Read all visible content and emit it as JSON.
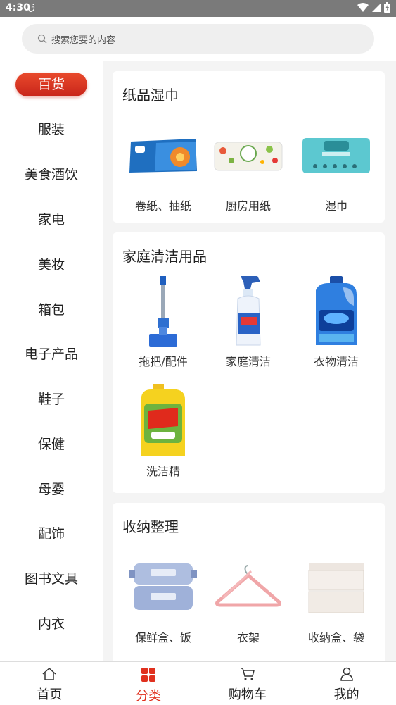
{
  "status_bar": {
    "time": "4:30",
    "carrier_glyph": "ق"
  },
  "search": {
    "placeholder": "搜索您要的内容"
  },
  "sidebar": {
    "items": [
      {
        "label": "百货"
      },
      {
        "label": "服装"
      },
      {
        "label": "美食酒饮"
      },
      {
        "label": "家电"
      },
      {
        "label": "美妆"
      },
      {
        "label": "箱包"
      },
      {
        "label": "电子产品"
      },
      {
        "label": "鞋子"
      },
      {
        "label": "保健"
      },
      {
        "label": "母婴"
      },
      {
        "label": "配饰"
      },
      {
        "label": "图书文具"
      },
      {
        "label": "内衣"
      }
    ],
    "active_index": 0
  },
  "sections": [
    {
      "title": "纸品湿巾",
      "products": [
        {
          "label": "卷纸、抽纸"
        },
        {
          "label": "厨房用纸"
        },
        {
          "label": "湿巾"
        }
      ]
    },
    {
      "title": "家庭清洁用品",
      "products": [
        {
          "label": "拖把/配件"
        },
        {
          "label": "家庭清洁"
        },
        {
          "label": "衣物清洁"
        },
        {
          "label": "洗洁精"
        }
      ]
    },
    {
      "title": "收纳整理",
      "products": [
        {
          "label": "保鲜盒、饭"
        },
        {
          "label": "衣架"
        },
        {
          "label": "收纳盒、袋"
        }
      ]
    }
  ],
  "tabbar": {
    "tabs": [
      {
        "label": "首页"
      },
      {
        "label": "分类"
      },
      {
        "label": "购物车"
      },
      {
        "label": "我的"
      }
    ],
    "active_index": 1
  },
  "colors": {
    "accent": "#e0301e",
    "pill": "#d6321f"
  }
}
